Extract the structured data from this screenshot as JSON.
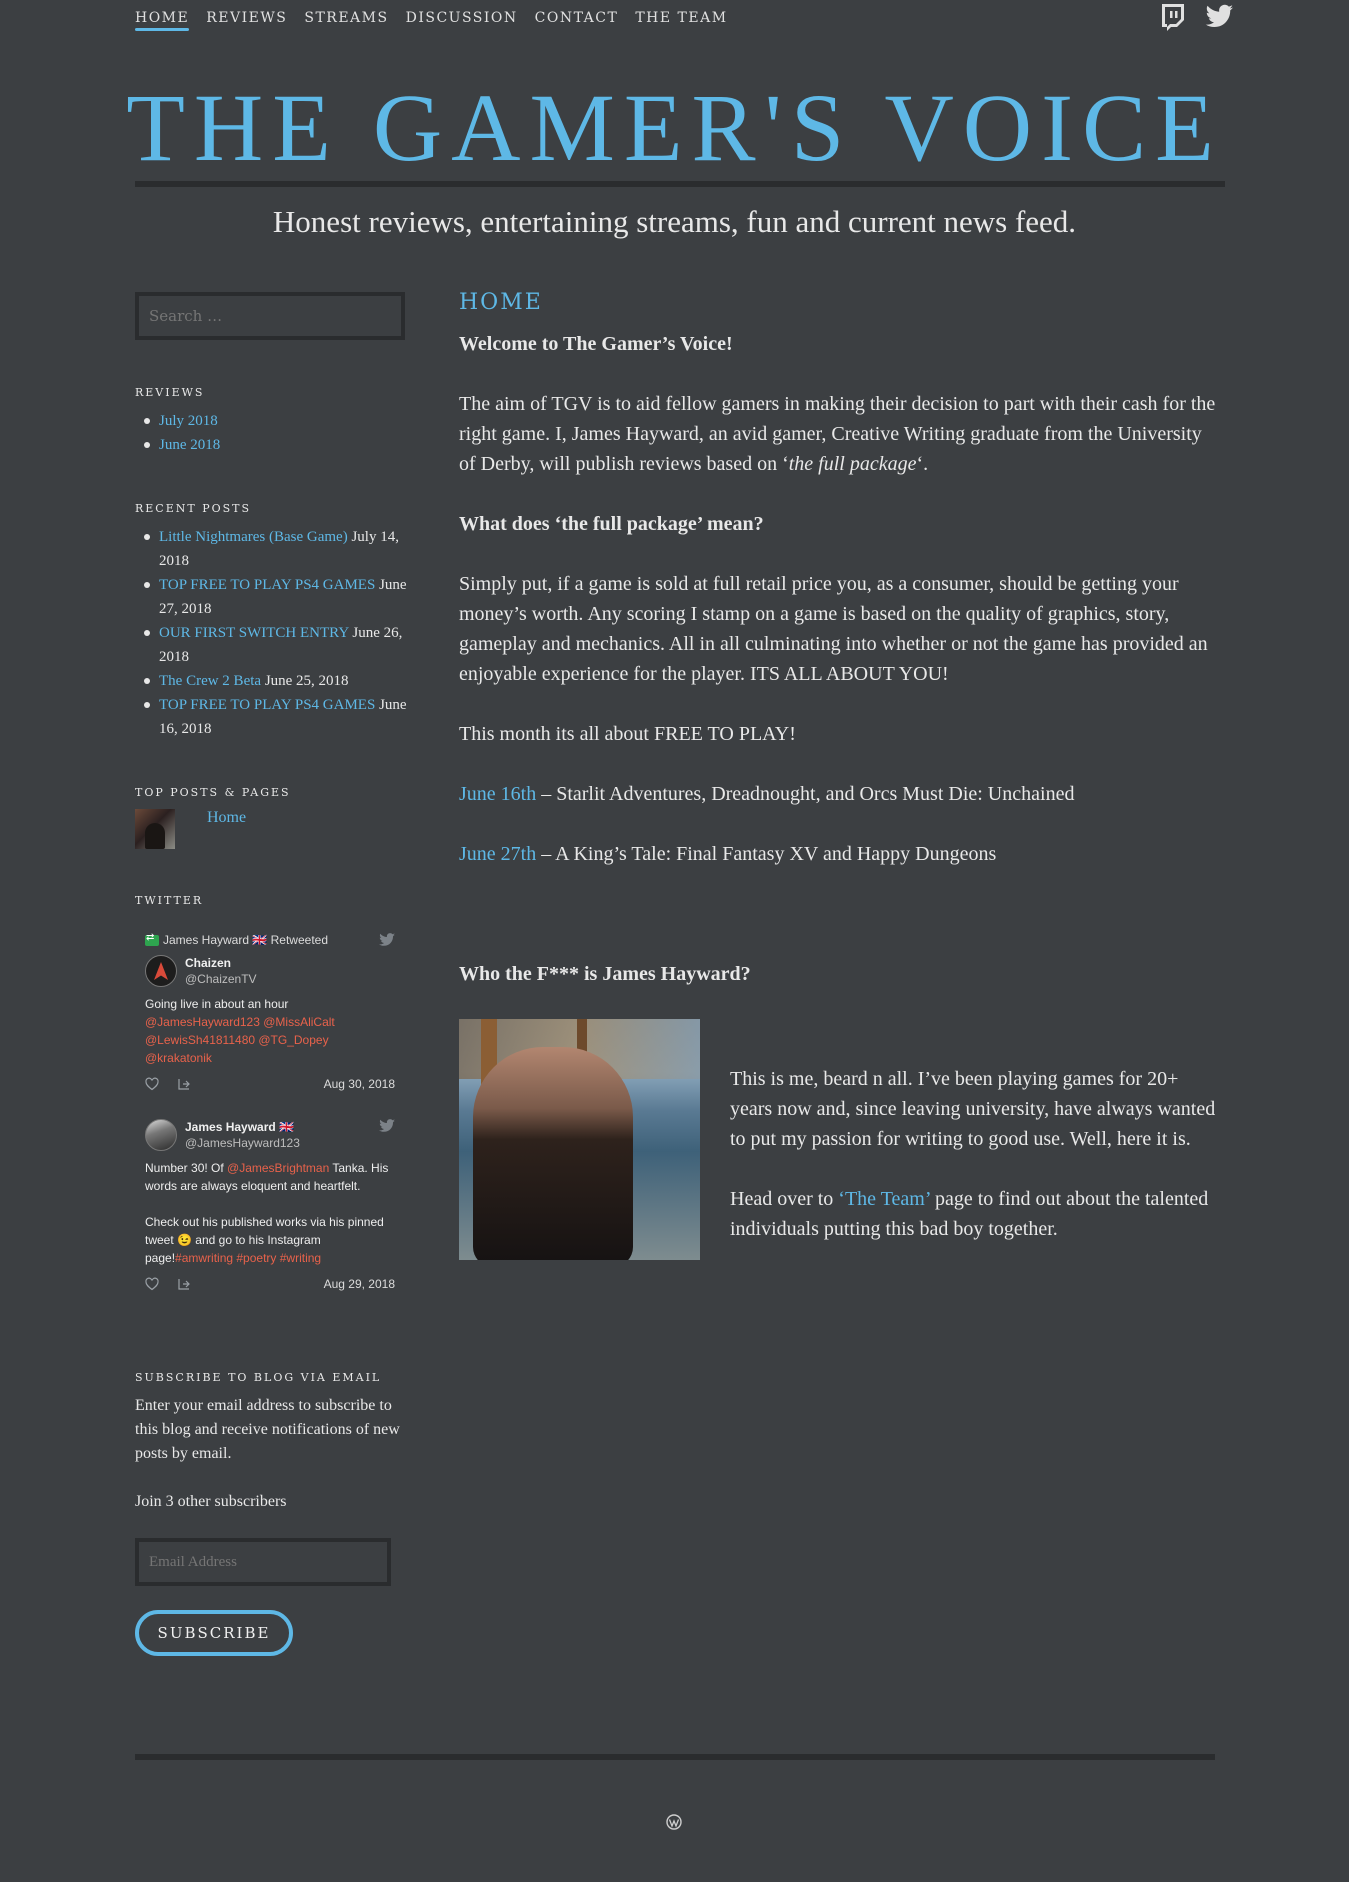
{
  "nav": {
    "items": [
      {
        "label": "HOME",
        "active": true
      },
      {
        "label": "REVIEWS",
        "active": false
      },
      {
        "label": "STREAMS",
        "active": false
      },
      {
        "label": "DISCUSSION",
        "active": false
      },
      {
        "label": "CONTACT",
        "active": false
      },
      {
        "label": "THE TEAM",
        "active": false
      }
    ],
    "social": [
      "twitch-icon",
      "twitter-icon"
    ]
  },
  "header": {
    "title": "THE GAMER'S VOICE",
    "tagline": "Honest reviews, entertaining streams, fun and current news feed."
  },
  "sidebar": {
    "search_placeholder": "Search …",
    "reviews": {
      "title": "REVIEWS",
      "items": [
        "July 2018",
        "June 2018"
      ]
    },
    "recent_posts": {
      "title": "RECENT POSTS",
      "items": [
        {
          "title": "Little Nightmares (Base Game)",
          "date": "July 14, 2018"
        },
        {
          "title": "TOP FREE TO PLAY PS4 GAMES",
          "date": "June 27, 2018"
        },
        {
          "title": "OUR FIRST SWITCH ENTRY",
          "date": "June 26, 2018"
        },
        {
          "title": "The Crew 2 Beta",
          "date": "June 25, 2018"
        },
        {
          "title": "TOP FREE TO PLAY PS4 GAMES",
          "date": "June 16, 2018"
        }
      ]
    },
    "top_posts": {
      "title": "TOP POSTS & PAGES",
      "items": [
        "Home"
      ]
    },
    "twitter": {
      "title": "TWITTER",
      "tweets": [
        {
          "retweet_by": "James Hayward 🇬🇧 Retweeted",
          "name": "Chaizen",
          "handle": "@ChaizenTV",
          "text_plain": "Going live in about an hour",
          "mentions": "@JamesHayward123 @MissAliCalt @LewisSh41811480 @TG_Dopey @krakatonik",
          "date": "Aug 30, 2018"
        },
        {
          "name": "James Hayward 🇬🇧",
          "handle": "@JamesHayward123",
          "text_1a": "Number 30! Of ",
          "text_1_link": "@JamesBrightman",
          "text_1b": " Tanka. His words are always eloquent and heartfelt.",
          "text_2a": "Check out his published works via his pinned tweet 😉 and go to his Instagram page!",
          "text_2_tags": "#amwriting #poetry #writing",
          "date": "Aug 29, 2018"
        }
      ]
    },
    "subscribe": {
      "title": "SUBSCRIBE TO BLOG VIA EMAIL",
      "description": "Enter your email address to subscribe to this blog and receive notifications of new posts by email.",
      "subscribers": "Join 3 other subscribers",
      "email_placeholder": "Email Address",
      "button_label": "SUBSCRIBE"
    }
  },
  "main": {
    "page_title": "HOME",
    "welcome": "Welcome to The Gamer’s Voice!",
    "aim_a": "The aim of TGV is to aid fellow gamers in making their decision to part with their cash for the right game. I, James Hayward, an avid gamer, Creative Writing graduate from the University of Derby, will publish reviews based on ‘",
    "aim_em": "the full package",
    "aim_b": "‘.",
    "question": "What does ‘the full package’ mean?",
    "explanation": "Simply put, if a game is sold at full retail price you, as a consumer, should be getting your money’s worth. Any scoring I stamp on a game is based on the quality of graphics, story, gameplay and mechanics. All in all culminating into whether or not the game has provided an enjoyable experience for the player. ITS ALL ABOUT YOU!",
    "month_line": "This month its all about FREE TO PLAY!",
    "schedule": [
      {
        "link": "June 16th",
        "text": " – Starlit Adventures, Dreadnought, and Orcs Must Die: Unchained"
      },
      {
        "link": "June 27th",
        "text": " – A King’s Tale: Final Fantasy XV and Happy Dungeons"
      }
    ],
    "who_heading": "Who the F*** is James Hayward?",
    "bio": "This is me, beard n all. I’ve been playing games for 20+ years now and, since leaving university, have always wanted to put my passion for writing to good use. Well, here it is.",
    "team_a": "Head over to ",
    "team_link": "‘The Team’",
    "team_b": " page to find out about the talented individuals putting this bad boy together."
  },
  "footer": {
    "icon": "wordpress-icon"
  }
}
